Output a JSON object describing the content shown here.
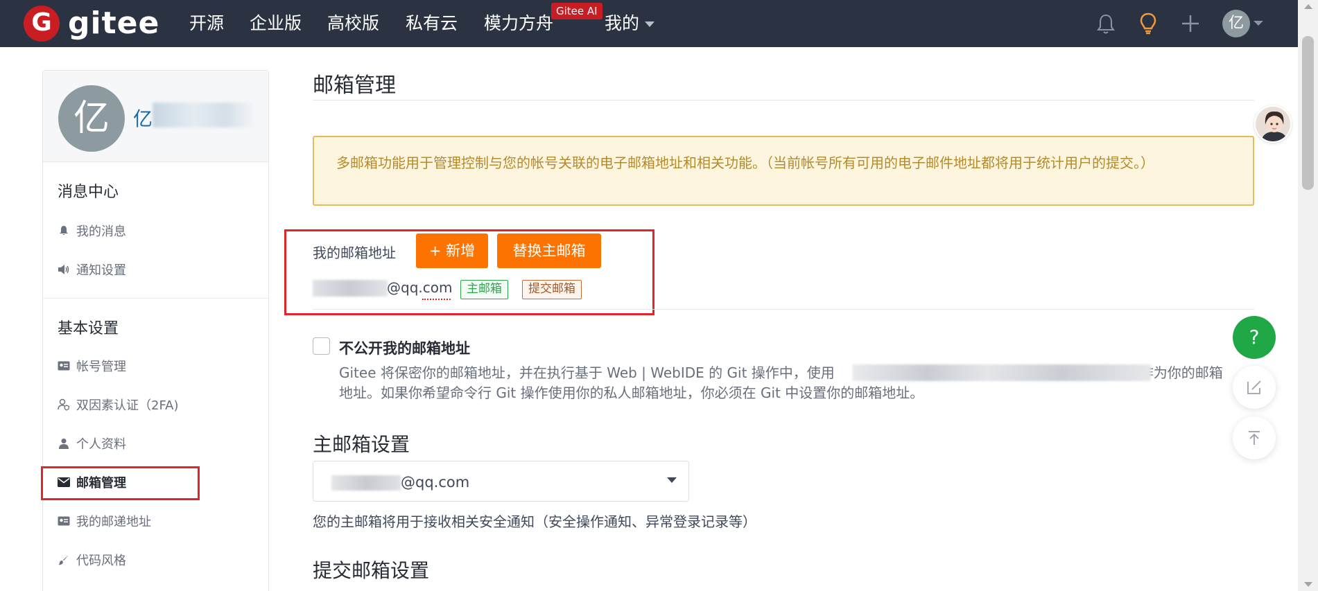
{
  "topnav": {
    "logo_letter": "G",
    "logo_text": "gitee",
    "items": [
      "开源",
      "企业版",
      "高校版",
      "私有云",
      "模力方舟",
      "我的"
    ],
    "ai_badge": "Gitee AI",
    "avatar_letter": "亿"
  },
  "sidebar": {
    "avatar_letter": "亿",
    "user_name": "亿",
    "sections": [
      {
        "title": "消息中心",
        "items": [
          {
            "label": "我的消息",
            "icon": "bell-icon"
          },
          {
            "label": "通知设置",
            "icon": "speaker-icon"
          }
        ]
      },
      {
        "title": "基本设置",
        "items": [
          {
            "label": "帐号管理",
            "icon": "id-card-icon"
          },
          {
            "label": "双因素认证（2FA)",
            "icon": "user-shield-icon"
          },
          {
            "label": "个人资料",
            "icon": "user-icon"
          },
          {
            "label": "邮箱管理",
            "icon": "envelope-icon",
            "active": true
          },
          {
            "label": "我的邮递地址",
            "icon": "address-card-icon"
          },
          {
            "label": "代码风格",
            "icon": "brush-icon"
          }
        ]
      }
    ]
  },
  "main": {
    "title": "邮箱管理",
    "notice": "多邮箱功能用于管理控制与您的帐号关联的电子邮箱地址和相关功能。（当前帐号所有可用的电子邮件地址都将用于统计用户的提交。）",
    "my_email_label": "我的邮箱地址",
    "add_button": "+ 新增",
    "replace_button": "替换主邮箱",
    "email_suffix": "@qq.com",
    "tags": [
      "主邮箱",
      "提交邮箱"
    ],
    "hide_email": {
      "label": "不公开我的邮箱地址",
      "desc_part1": "Gitee 将保密你的邮箱地址，并在执行基于 Web | WebIDE 的 Git 操作中，使用",
      "desc_part2": "作为你的邮箱",
      "desc_line2": "地址。如果你希望命令行 Git 操作使用你的私人邮箱地址，你必须在 Git 中设置你的邮箱地址。",
      "checked": false
    },
    "primary_heading": "主邮箱设置",
    "primary_select_value": "@qq.com",
    "primary_hint": "您的主邮箱将用于接收相关安全通知（安全操作通知、异常登录记录等）",
    "commit_heading": "提交邮箱设置"
  },
  "floating": {
    "help": "?"
  },
  "colors": {
    "nav_bg": "#2b3342",
    "brand_red": "#c71d23",
    "accent_orange": "#fe7300",
    "notice_bg": "#fdf5de",
    "notice_border": "#e6bc5a",
    "help_green": "#21a846",
    "highlight_red": "#e0262c"
  }
}
